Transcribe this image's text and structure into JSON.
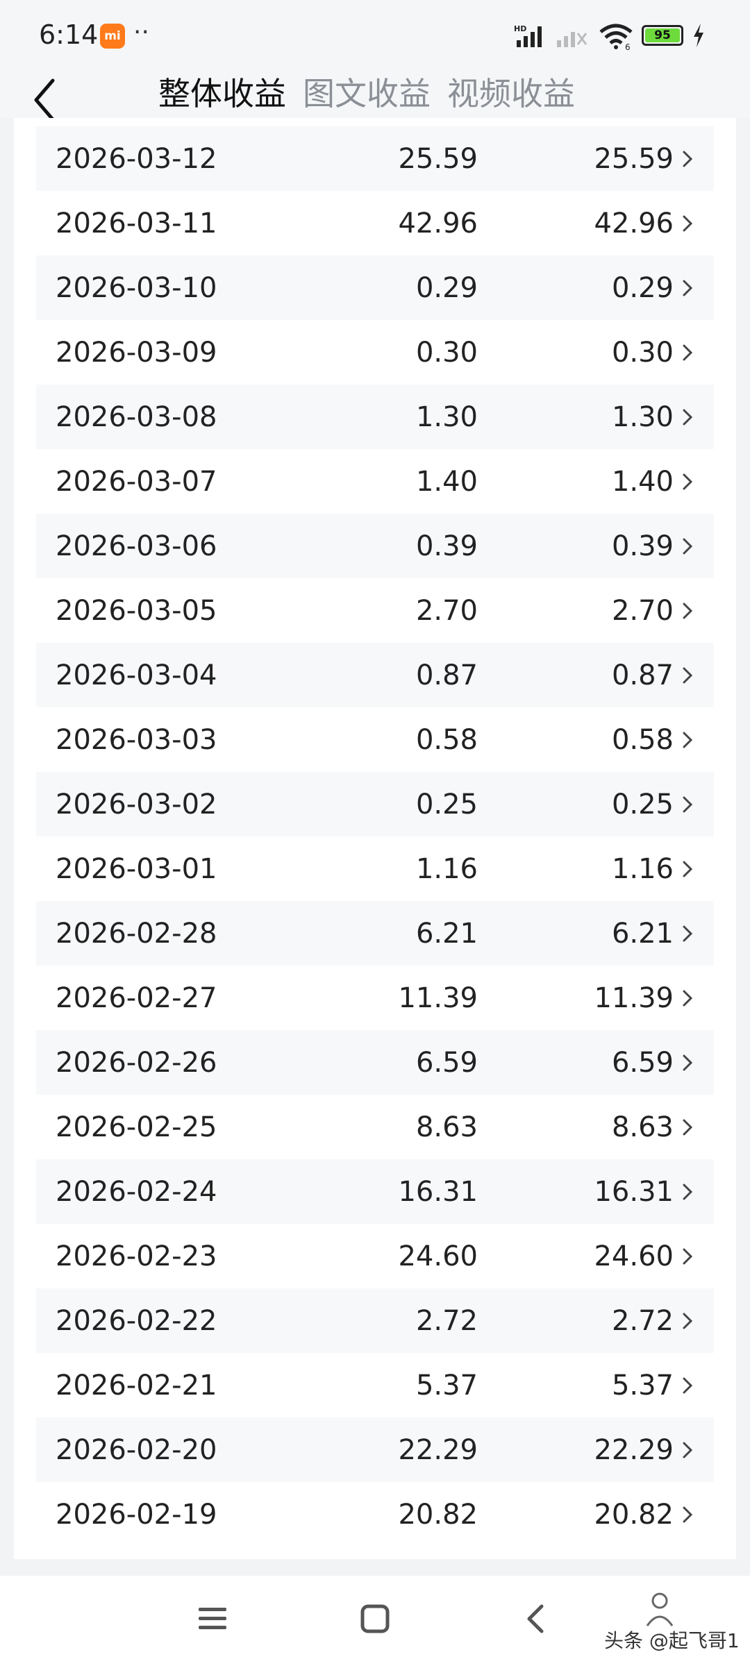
{
  "status_bar": {
    "time": "6:14",
    "app_badge": "mi",
    "more": "··",
    "network": "HD",
    "battery": "95"
  },
  "header": {
    "tabs": [
      {
        "label": "整体收益",
        "active": true
      },
      {
        "label": "图文收益",
        "active": false
      },
      {
        "label": "视频收益",
        "active": false
      }
    ]
  },
  "table": {
    "rows": [
      {
        "date": "2026-03-12",
        "total": "25.59",
        "article": "25.59"
      },
      {
        "date": "2026-03-11",
        "total": "42.96",
        "article": "42.96"
      },
      {
        "date": "2026-03-10",
        "total": "0.29",
        "article": "0.29"
      },
      {
        "date": "2026-03-09",
        "total": "0.30",
        "article": "0.30"
      },
      {
        "date": "2026-03-08",
        "total": "1.30",
        "article": "1.30"
      },
      {
        "date": "2026-03-07",
        "total": "1.40",
        "article": "1.40"
      },
      {
        "date": "2026-03-06",
        "total": "0.39",
        "article": "0.39"
      },
      {
        "date": "2026-03-05",
        "total": "2.70",
        "article": "2.70"
      },
      {
        "date": "2026-03-04",
        "total": "0.87",
        "article": "0.87"
      },
      {
        "date": "2026-03-03",
        "total": "0.58",
        "article": "0.58"
      },
      {
        "date": "2026-03-02",
        "total": "0.25",
        "article": "0.25"
      },
      {
        "date": "2026-03-01",
        "total": "1.16",
        "article": "1.16"
      },
      {
        "date": "2026-02-28",
        "total": "6.21",
        "article": "6.21"
      },
      {
        "date": "2026-02-27",
        "total": "11.39",
        "article": "11.39"
      },
      {
        "date": "2026-02-26",
        "total": "6.59",
        "article": "6.59"
      },
      {
        "date": "2026-02-25",
        "total": "8.63",
        "article": "8.63"
      },
      {
        "date": "2026-02-24",
        "total": "16.31",
        "article": "16.31"
      },
      {
        "date": "2026-02-23",
        "total": "24.60",
        "article": "24.60"
      },
      {
        "date": "2026-02-22",
        "total": "2.72",
        "article": "2.72"
      },
      {
        "date": "2026-02-21",
        "total": "5.37",
        "article": "5.37"
      },
      {
        "date": "2026-02-20",
        "total": "22.29",
        "article": "22.29"
      },
      {
        "date": "2026-02-19",
        "total": "20.82",
        "article": "20.82"
      }
    ]
  },
  "watermark": "头条 @起飞哥1",
  "colors": {
    "page_bg": "#f2f3f5",
    "card_bg": "#ffffff",
    "row_alt": "#f7f8fa",
    "active_tab": "#111111",
    "inactive_tab": "#8b8f96",
    "battery": "#6ddb3c",
    "mi_badge": "#ff7a1a"
  }
}
